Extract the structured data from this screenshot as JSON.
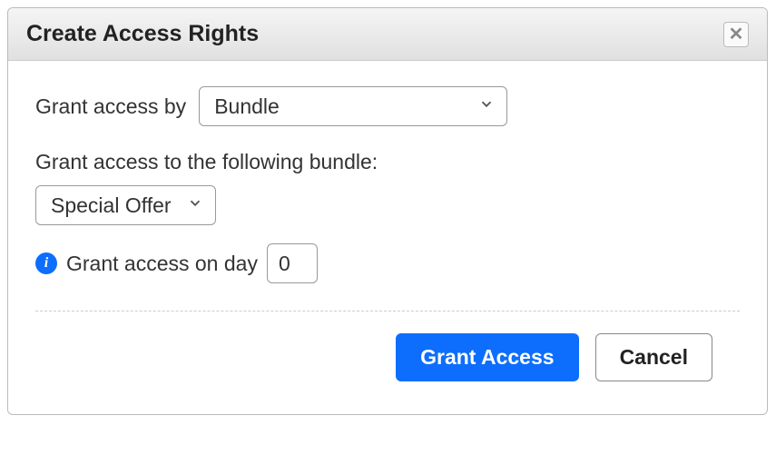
{
  "dialog": {
    "title": "Create Access Rights",
    "grant_by_label": "Grant access by",
    "grant_by_value": "Bundle",
    "grant_to_label": "Grant access to the following bundle:",
    "bundle_value": "Special Offer",
    "day_label": "Grant access on day",
    "day_value": "0",
    "primary_btn": "Grant Access",
    "cancel_btn": "Cancel"
  }
}
